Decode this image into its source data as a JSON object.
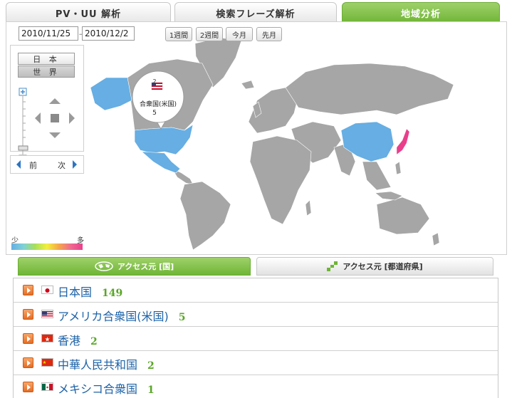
{
  "tabs": {
    "pv_uu": "PV・UU 解析",
    "search_phrase": "検索フレーズ解析",
    "region": "地域分析"
  },
  "date_range": {
    "from": "2010/11/25",
    "separator": "－",
    "to": "2010/12/2"
  },
  "period_buttons": [
    "1週間",
    "2週間",
    "今月",
    "先月"
  ],
  "region_buttons": {
    "japan": "日 本",
    "world": "世 界"
  },
  "nav": {
    "prev": "前",
    "next": "次"
  },
  "map_tooltip": {
    "rank": "2",
    "country": "合衆国(米国)",
    "count": "5"
  },
  "legend": {
    "low": "少",
    "high": "多"
  },
  "country_tabs": {
    "country": "アクセス元 [国]",
    "prefecture": "アクセス元 [都道府県]"
  },
  "countries": [
    {
      "name": "日本国",
      "count": "149",
      "flag": "japan"
    },
    {
      "name": "アメリカ合衆国(米国)",
      "count": "5",
      "flag": "usa"
    },
    {
      "name": "香港",
      "count": "2",
      "flag": "hong-kong"
    },
    {
      "name": "中華人民共和国",
      "count": "2",
      "flag": "china"
    },
    {
      "name": "メキシコ合衆国",
      "count": "1",
      "flag": "mexico"
    }
  ],
  "colors": {
    "accent_green": "#7cbc3e",
    "highlight_blue": "#66aee3",
    "highlight_pink": "#e93f8b",
    "land_gray": "#a6a6a6",
    "link_blue": "#1d62a7",
    "count_green": "#5aa628"
  }
}
